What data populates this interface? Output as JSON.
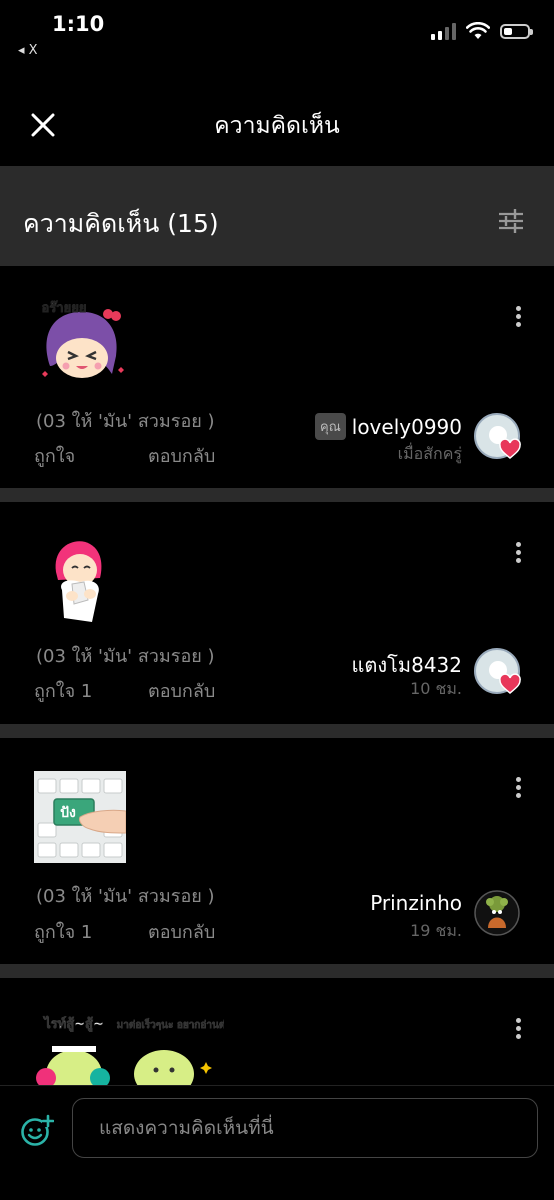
{
  "status_bar": {
    "time": "1:10",
    "back_app": "◂ X"
  },
  "nav": {
    "title": "ความคิดเห็น"
  },
  "section": {
    "title": "ความคิดเห็น (15)"
  },
  "comments": [
    {
      "sticker": "sticker-purple-girl-angry",
      "sticker_text": "อร๊ายยย",
      "text": "(03 ให้ 'มัน' สวมรอย )",
      "like": "ถูกใจ",
      "reply": "ตอบกลับ",
      "you_badge": "คุณ",
      "author": "lovely0990",
      "time": "เมื่อสักครู่",
      "avatar": "default-avatar-with-heart"
    },
    {
      "sticker": "sticker-pink-girl-tissue",
      "text": "(03 ให้ 'มัน' สวมรอย )",
      "like": "ถูกใจ 1",
      "reply": "ตอบกลับ",
      "author": "แตงโม8432",
      "time": "10 ชม.",
      "avatar": "default-avatar-with-heart"
    },
    {
      "sticker": "sticker-keyboard-key",
      "sticker_text": "ปัง",
      "text": "(03 ให้ 'มัน' สวมรอย )",
      "like": "ถูกใจ 1",
      "reply": "ตอบกลับ",
      "author": "Prinzinho",
      "time": "19 ชม.",
      "avatar": "photo-avatar"
    },
    {
      "sticker": "sticker-cats-pair",
      "sticker_text_1": "ไรท์สู้~สู้~",
      "sticker_text_2": "มาต่อเร็วๆนะ อยากอ่านต่อ"
    }
  ],
  "input": {
    "placeholder": "แสดงความคิดเห็นที่นี่"
  },
  "colors": {
    "background": "#000000",
    "header_bg": "#2b2b2b",
    "accent": "#2bb3a8",
    "heart": "#e8375a"
  }
}
